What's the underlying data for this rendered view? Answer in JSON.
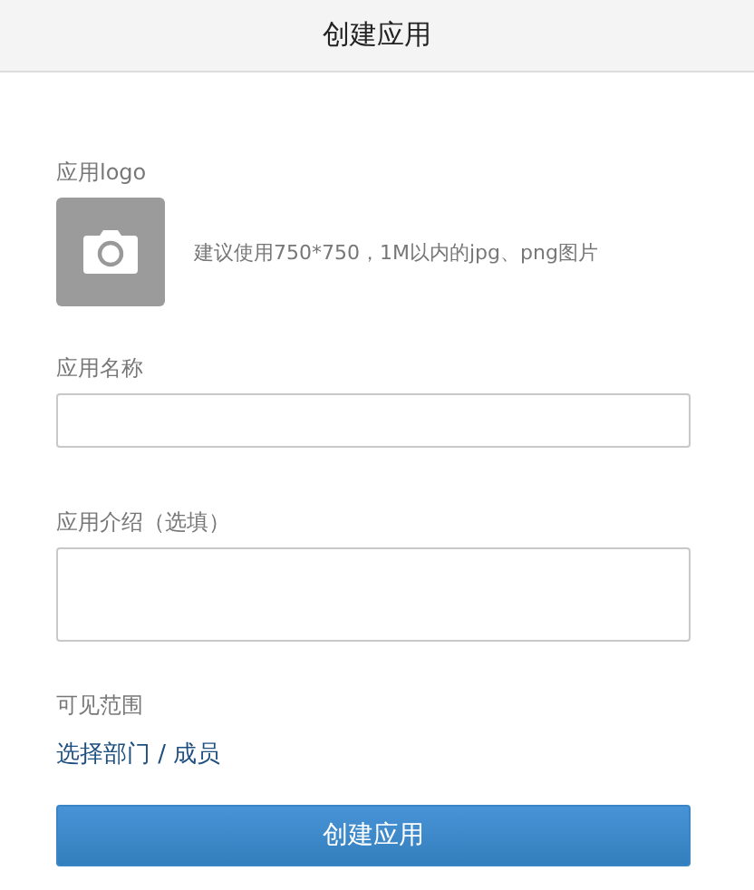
{
  "header": {
    "title": "创建应用"
  },
  "logo": {
    "label": "应用logo",
    "hint": "建议使用750*750，1M以内的jpg、png图片"
  },
  "fields": [
    {
      "kind": "input",
      "label": "应用名称"
    },
    {
      "kind": "textarea",
      "label": "应用介绍（选填）"
    }
  ],
  "visibility": {
    "label": "可见范围",
    "link": "选择部门 / 成员"
  },
  "submit": "创建应用"
}
